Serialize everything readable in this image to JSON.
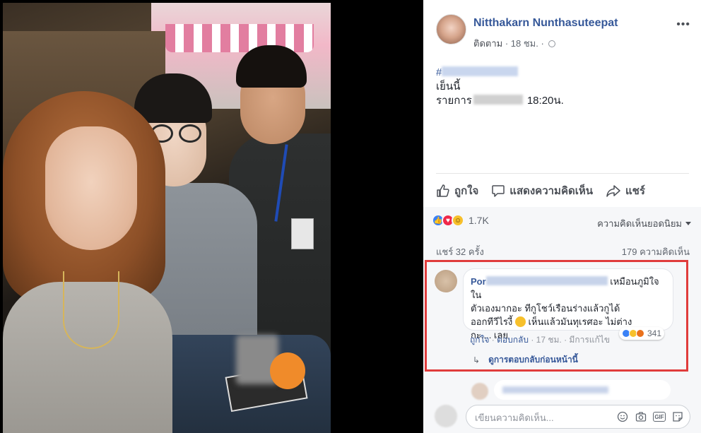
{
  "post": {
    "author": "Nitthakarn Nunthasuteepat",
    "follow_label": "ติดตาม",
    "time": "18 ชม.",
    "more": "•••",
    "text_line1_prefix": "#",
    "text_line2": "เย็นนี้",
    "text_line3_prefix": "รายการ",
    "text_line3_time": "18:20น."
  },
  "actions": {
    "like": "ถูกใจ",
    "comment": "แสดงความคิดเห็น",
    "share": "แชร์"
  },
  "stats": {
    "reactions_count": "1.7K",
    "sort_label": "ความคิดเห็นยอดนิยม",
    "shares": "แชร์ 32 ครั้ง",
    "comments": "179 ความคิดเห็น"
  },
  "comment": {
    "name_prefix": "Por",
    "text_a": "เหมือนภูมิใจใน",
    "text_b": "ตัวเองมากอะ ทีกูโชว์เรือนร่างแล้วกูได้",
    "text_c": "ออกทีวีไรงี้",
    "text_d": "เห็นแล้วมันทุเรศอะ ไม่ต่าง",
    "text_e": "กะ.... เลย",
    "reaction_count": "341",
    "like": "ถูกใจ",
    "reply": "ตอบกลับ",
    "time": "17 ชม.",
    "edited": "มีการแก้ไข",
    "view_replies": "ดูการตอบกลับก่อนหน้านี้"
  },
  "compose": {
    "placeholder": "เขียนความคิดเห็น..."
  }
}
